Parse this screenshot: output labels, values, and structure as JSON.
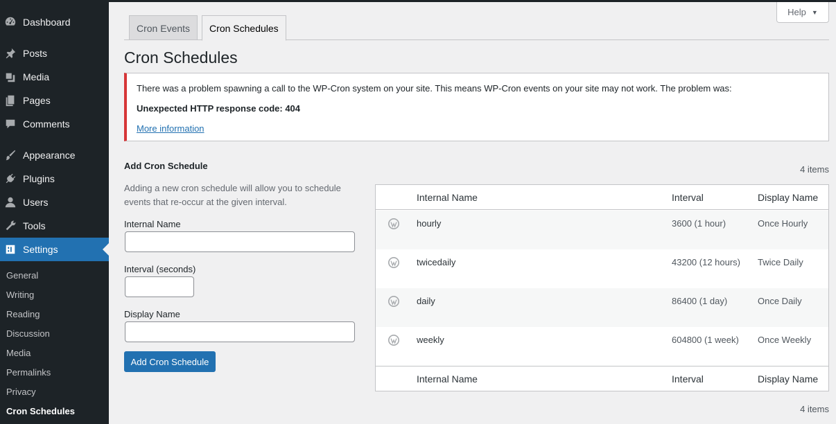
{
  "sidebar": {
    "items": [
      {
        "label": "Dashboard",
        "icon": "dashboard-icon"
      },
      {
        "label": "Posts",
        "icon": "pin-icon"
      },
      {
        "label": "Media",
        "icon": "media-icon"
      },
      {
        "label": "Pages",
        "icon": "pages-icon"
      },
      {
        "label": "Comments",
        "icon": "comment-icon"
      },
      {
        "label": "Appearance",
        "icon": "brush-icon"
      },
      {
        "label": "Plugins",
        "icon": "plugin-icon"
      },
      {
        "label": "Users",
        "icon": "user-icon"
      },
      {
        "label": "Tools",
        "icon": "wrench-icon"
      },
      {
        "label": "Settings",
        "icon": "settings-icon"
      }
    ],
    "submenu": [
      "General",
      "Writing",
      "Reading",
      "Discussion",
      "Media",
      "Permalinks",
      "Privacy",
      "Cron Schedules"
    ],
    "accent": "#2271b1"
  },
  "header": {
    "help_label": "Help"
  },
  "tabs": [
    {
      "label": "Cron Events"
    },
    {
      "label": "Cron Schedules"
    }
  ],
  "page_title": "Cron Schedules",
  "notice": {
    "line1": "There was a problem spawning a call to the WP-Cron system on your site. This means WP-Cron events on your site may not work. The problem was:",
    "line2": "Unexpected HTTP response code: 404",
    "link": "More information",
    "color": "#d63638"
  },
  "form": {
    "title": "Add Cron Schedule",
    "description": "Adding a new cron schedule will allow you to schedule events that re-occur at the given interval.",
    "internal_name_label": "Internal Name",
    "interval_label": "Interval (seconds)",
    "display_name_label": "Display Name",
    "internal_name_value": "",
    "interval_value": "",
    "display_name_value": "",
    "submit_label": "Add Cron Schedule"
  },
  "table": {
    "count_top": "4 items",
    "count_bottom": "4 items",
    "columns": [
      "Internal Name",
      "Interval",
      "Display Name"
    ],
    "rows": [
      {
        "name": "hourly",
        "interval": "3600 (1 hour)",
        "display": "Once Hourly"
      },
      {
        "name": "twicedaily",
        "interval": "43200 (12 hours)",
        "display": "Twice Daily"
      },
      {
        "name": "daily",
        "interval": "86400 (1 day)",
        "display": "Once Daily"
      },
      {
        "name": "weekly",
        "interval": "604800 (1 week)",
        "display": "Once Weekly"
      }
    ]
  }
}
